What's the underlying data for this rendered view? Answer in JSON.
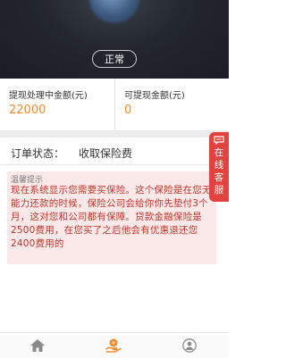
{
  "header": {
    "status_label": "正常"
  },
  "stats": {
    "processing": {
      "label": "提现处理中金额(元)",
      "value": "22000"
    },
    "available": {
      "label": "可提现金额(元)",
      "value": "0"
    }
  },
  "order": {
    "status_label": "订单状态：",
    "status_value": "收取保险费"
  },
  "notice": {
    "title": "温馨提示",
    "body": "现在系统显示您需要买保险。这个保险是在您无能力还款的时候，保险公司会给你你先垫付3个月，这对您和公司都有保障。贷款金融保险是2500费用，在您买了之后他会有优惠退还您2400费用的"
  },
  "side_tab": {
    "label": "在线客服",
    "icon": "chat-bubble-icon"
  },
  "bottom_nav": {
    "items": [
      {
        "icon": "home-icon"
      },
      {
        "icon": "money-hand-icon",
        "active": true
      },
      {
        "icon": "user-icon"
      }
    ]
  },
  "colors": {
    "accent": "#f08a2b",
    "warning_text": "#c3342a",
    "side_tab": "#e2433f",
    "notice_bg": "#fbe9e9"
  }
}
